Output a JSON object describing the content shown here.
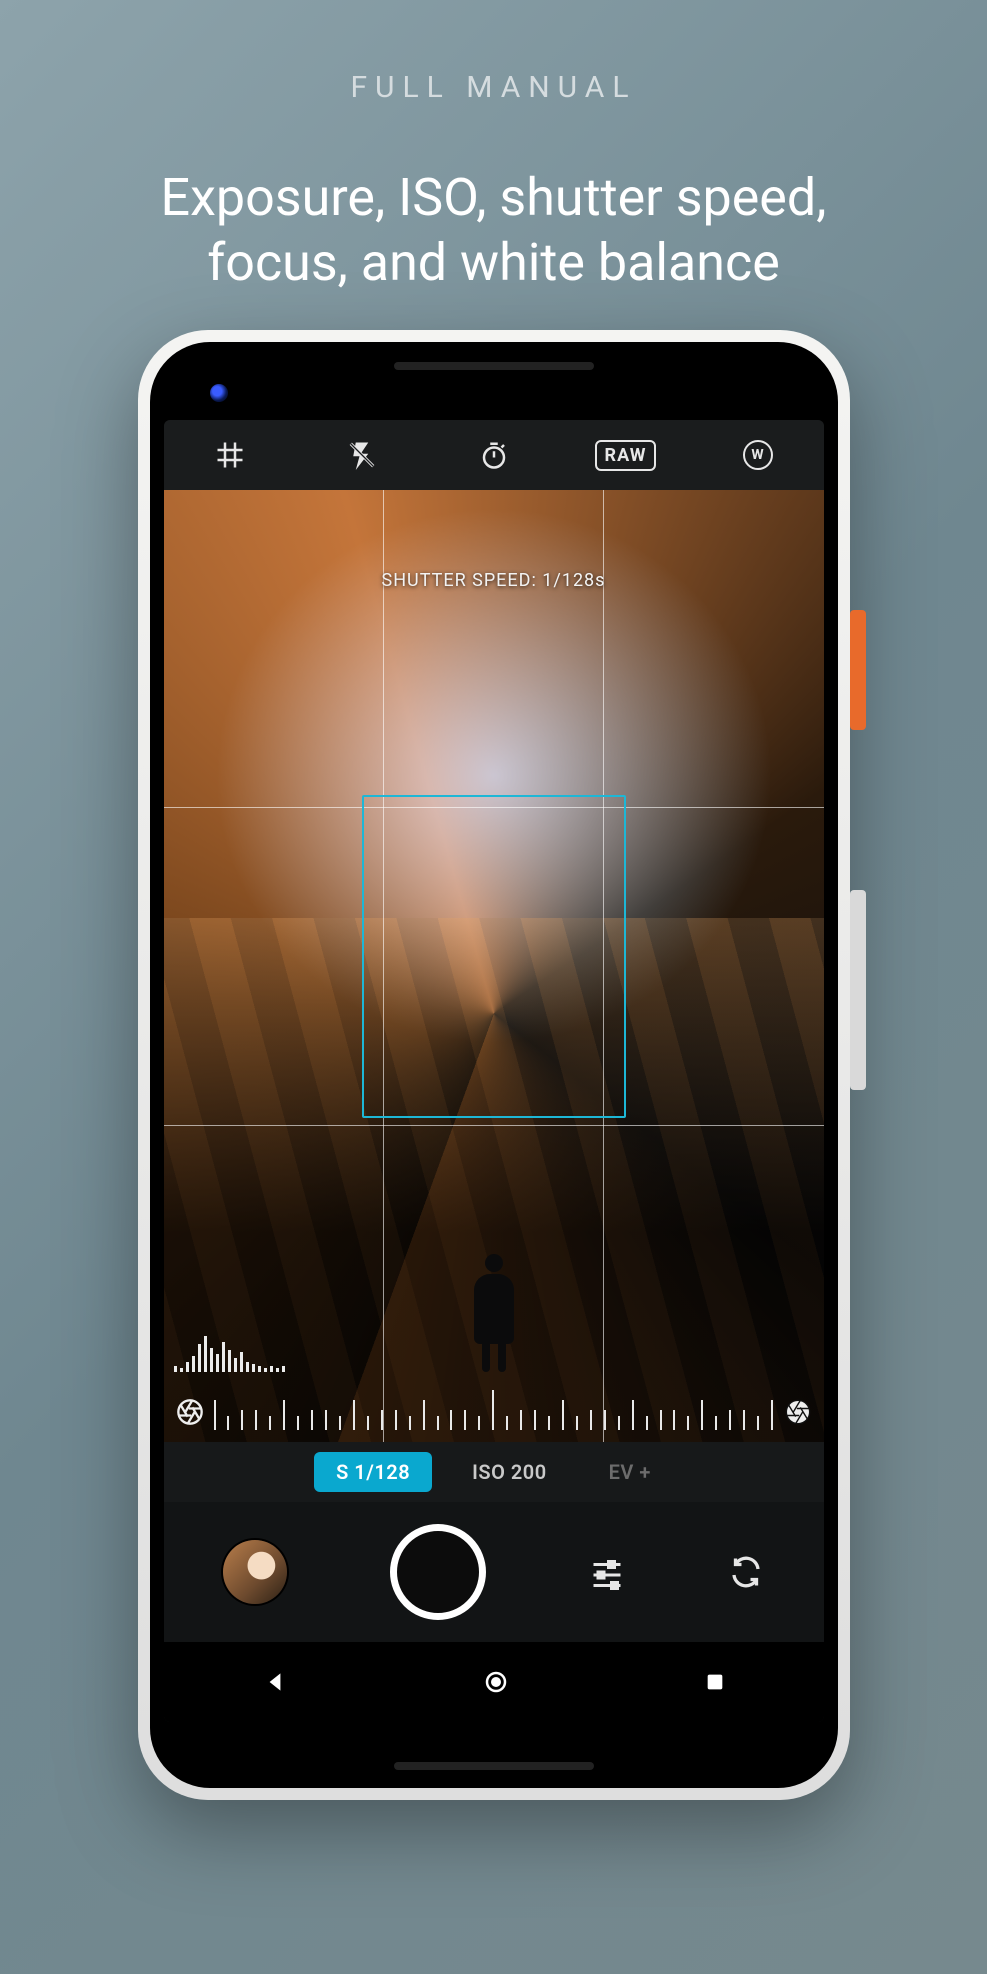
{
  "promo": {
    "eyebrow": "FULL MANUAL",
    "headline_line1": "Exposure, ISO, shutter speed,",
    "headline_line2": "focus, and white balance"
  },
  "topbar": {
    "grid_icon": "grid-icon",
    "flash_icon": "flash-off-icon",
    "timer_icon": "timer-icon",
    "raw_label": "RAW",
    "wb_label": "W"
  },
  "viewfinder": {
    "shutter_overlay_label": "SHUTTER SPEED: 1/128s"
  },
  "modes": {
    "shutter_active": "S 1/128",
    "iso": "ISO 200",
    "ev": "EV +"
  },
  "histogram_heights": [
    6,
    4,
    10,
    16,
    28,
    36,
    24,
    18,
    30,
    22,
    14,
    20,
    10,
    8,
    6,
    4,
    6,
    4,
    6
  ],
  "colors": {
    "accent": "#0aa8cf",
    "focus_box": "#1db7d6"
  }
}
